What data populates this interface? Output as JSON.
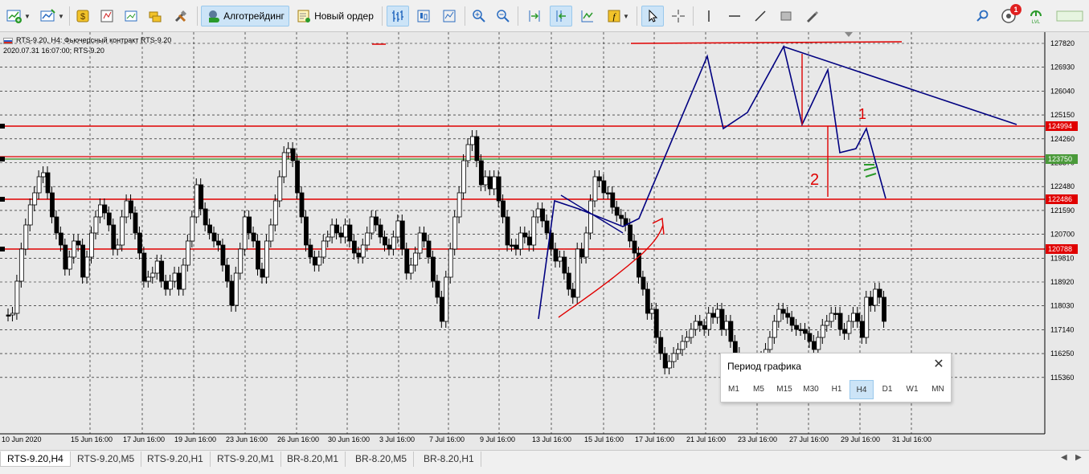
{
  "toolbar": {
    "algotrading_label": "Алготрейдинг",
    "new_order_label": "Новый ордер",
    "notification_count": "1"
  },
  "chart": {
    "symbol_line": "RTS-9.20, H4:  Фьючерсный контракт RTS-9.20",
    "info_line": "2020.07.31 16:07:00; RTS-9.20",
    "price_ticks": [
      "127820",
      "126930",
      "126040",
      "125150",
      "124260",
      "123370",
      "122480",
      "121590",
      "120700",
      "119810",
      "118920",
      "118030",
      "117140",
      "116250",
      "115360"
    ],
    "date_ticks": [
      "10 Jun 2020",
      "15 Jun 16:00",
      "17 Jun 16:00",
      "19 Jun 16:00",
      "23 Jun 16:00",
      "26 Jun 16:00",
      "30 Jun 16:00",
      "3 Jul 16:00",
      "7 Jul 16:00",
      "9 Jul 16:00",
      "13 Jul 16:00",
      "15 Jul 16:00",
      "17 Jul 16:00",
      "21 Jul 16:00",
      "23 Jul 16:00",
      "27 Jul 16:00",
      "29 Jul 16:00",
      "31 Jul 16:00"
    ],
    "level_labels": [
      "124994",
      "123750",
      "122486",
      "120788"
    ],
    "annotations": [
      "1",
      "2"
    ],
    "colors": {
      "bg": "#e8e8e8",
      "grid": "#000000",
      "candle": "#000000",
      "level": "#e00000",
      "trend": "#000080",
      "green_level": "#4a9a3a"
    }
  },
  "period_popup": {
    "title": "Период графика",
    "periods": [
      "M1",
      "M5",
      "M15",
      "M30",
      "H1",
      "H4",
      "D1",
      "W1",
      "MN"
    ],
    "active": "H4"
  },
  "tabs": [
    "RTS-9.20,H4",
    "RTS-9.20,M5",
    "RTS-9.20,H1",
    "RTS-9.20,M1",
    "BR-8.20,M1",
    "BR-8.20,M5",
    "BR-8.20,H1"
  ],
  "active_tab": "RTS-9.20,H4"
}
